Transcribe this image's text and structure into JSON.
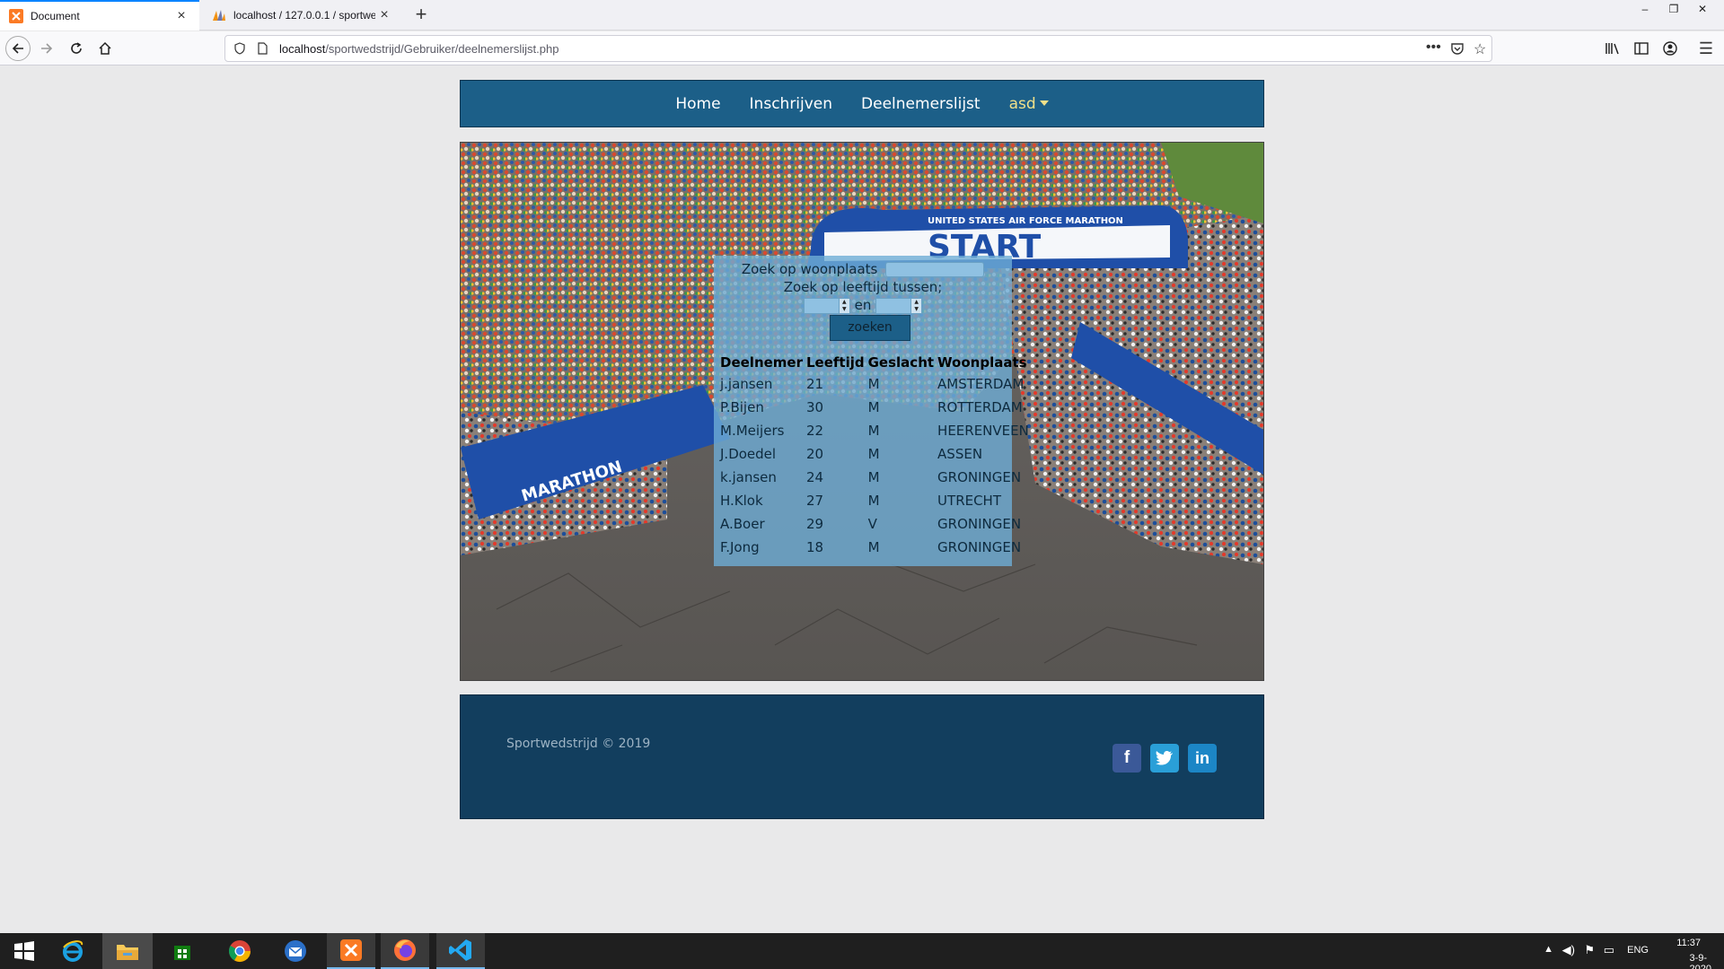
{
  "browser": {
    "tabs": [
      {
        "title": "Document",
        "active": true
      },
      {
        "title": "localhost / 127.0.0.1 / sportwed",
        "active": false
      }
    ],
    "url_host": "localhost",
    "url_path": "/sportwedstrijd/Gebruiker/deelnemerslijst.php"
  },
  "site": {
    "nav": {
      "home": "Home",
      "inschrijven": "Inschrijven",
      "deelnemerslijst": "Deelnemerslijst",
      "user": "asd"
    },
    "hero_image": {
      "banner_text": "START",
      "banner_subtext": "UNITED STATES AIR FORCE MARATHON",
      "side_banner_text": "MARATHON"
    },
    "search": {
      "woonplaats_label": "Zoek op woonplaats",
      "leeftijd_label": "Zoek op leeftijd tussen;",
      "and_label": "en",
      "button_label": "zoeken"
    },
    "table": {
      "headers": [
        "Deelnemer",
        "Leeftijd",
        "Geslacht",
        "Woonplaats"
      ],
      "rows": [
        [
          "j.jansen",
          "21",
          "M",
          "AMSTERDAM"
        ],
        [
          "P.Bijen",
          "30",
          "M",
          "ROTTERDAM"
        ],
        [
          "M.Meijers",
          "22",
          "M",
          "HEERENVEEN"
        ],
        [
          "J.Doedel",
          "20",
          "M",
          "ASSEN"
        ],
        [
          "k.jansen",
          "24",
          "M",
          "GRONINGEN"
        ],
        [
          "H.Klok",
          "27",
          "M",
          "UTRECHT"
        ],
        [
          "A.Boer",
          "29",
          "V",
          "GRONINGEN"
        ],
        [
          "F.Jong",
          "18",
          "M",
          "GRONINGEN"
        ]
      ]
    },
    "footer": {
      "copyright": "Sportwedstrijd © 2019",
      "social_icons": [
        "facebook-icon",
        "twitter-icon",
        "linkedin-icon"
      ]
    },
    "colors": {
      "nav_bg": "#1c5f88",
      "footer_bg": "#123e5e",
      "user_link": "#f0e08a"
    }
  },
  "taskbar": {
    "language": "ENG",
    "time": "11:37",
    "date": "3-9-2020"
  }
}
